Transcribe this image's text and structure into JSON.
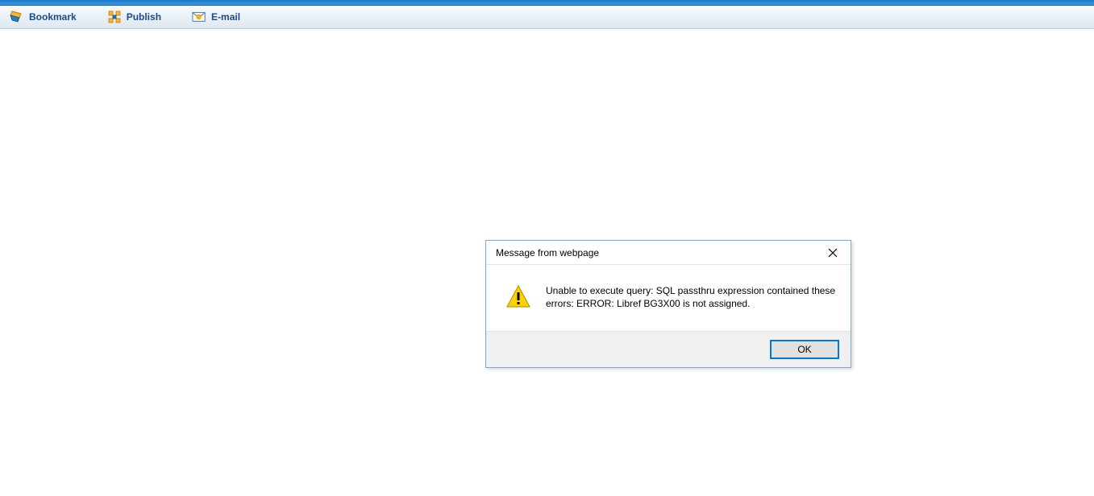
{
  "toolbar": {
    "bookmark_label": "Bookmark",
    "publish_label": "Publish",
    "email_label": "E-mail"
  },
  "dialog": {
    "title": "Message from webpage",
    "message": "Unable to execute query: SQL passthru expression contained these errors: ERROR: Libref BG3X00 is not assigned.",
    "ok_label": "OK"
  }
}
